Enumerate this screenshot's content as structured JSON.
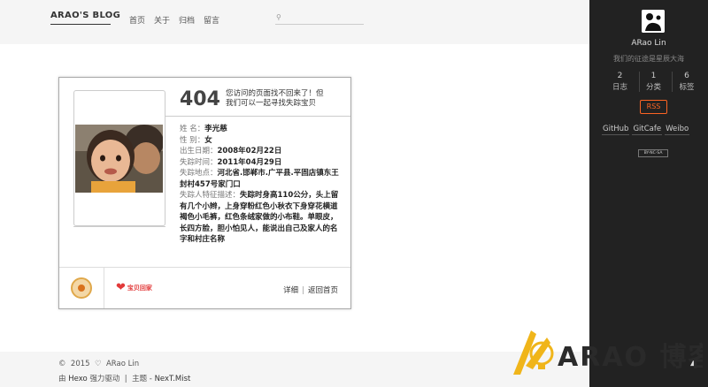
{
  "header": {
    "site_title": "ARAO'S BLOG",
    "nav": [
      "首页",
      "关于",
      "归档",
      "留言"
    ],
    "search_placeholder": ""
  },
  "error_card": {
    "code": "404",
    "message": "您访问的页面找不回来了！但我们可以一起寻找失踪宝贝",
    "info": [
      {
        "label": "姓 名：",
        "value": "李光慈"
      },
      {
        "label": "性 别：",
        "value": "女"
      },
      {
        "label": "出生日期：",
        "value": "2008年02月22日"
      },
      {
        "label": "失踪时间：",
        "value": "2011年04月29日"
      },
      {
        "label": "失踪地点：",
        "value": "河北省.邯郸市.广平县.平固店镇东王封村457号家门口"
      },
      {
        "label": "失踪人特征描述：",
        "value": "失踪时身高110公分，头上留有几个小辫，上身穿粉红色小秋衣下身穿花横道褐色小毛裤，红色条绒家做的小布鞋。单眼皮，长四方脸，胆小怕见人，能说出自己及家人的名字和村庄名称"
      }
    ],
    "partner_logo_text": "宝贝回家",
    "link_detail": "详细",
    "link_separator": "|",
    "link_home": "返回首页"
  },
  "footer": {
    "copyright_symbol": "©",
    "year": "2015",
    "author": "ARao Lin",
    "powered_prefix": "由",
    "powered_link": "Hexo",
    "powered_suffix": "强力驱动",
    "separator": "|",
    "theme_prefix": "主题 -",
    "theme_link": "NexT.Mist"
  },
  "sidebar": {
    "author": "ARao Lin",
    "motto": "我们的征途是星辰大海",
    "stats": [
      {
        "count": "2",
        "label": "日志"
      },
      {
        "count": "1",
        "label": "分类"
      },
      {
        "count": "6",
        "label": "标签"
      }
    ],
    "rss": "RSS",
    "social": [
      "GitHub",
      "GitCafe",
      "Weibo"
    ],
    "license": "BY-NC-SA"
  },
  "watermark_text": "ARAO 博客",
  "colors": {
    "sidebar_bg": "#222222",
    "rss_accent": "#fc6423",
    "header_bg": "#f5f5f5",
    "watermark": "#f0b51a"
  }
}
